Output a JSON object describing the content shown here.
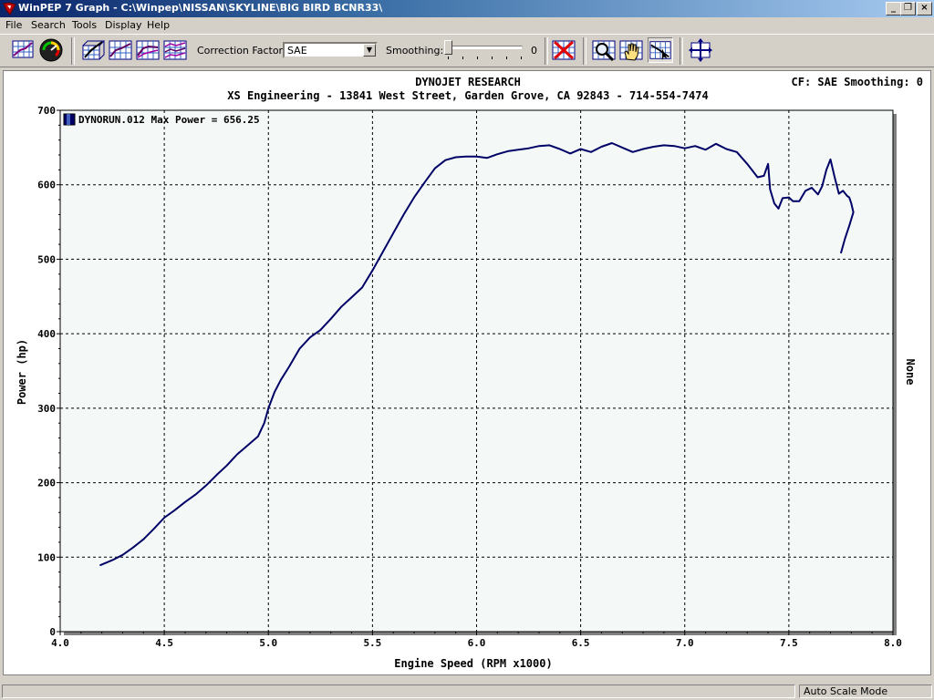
{
  "window": {
    "title": "WinPEP 7    Graph - C:\\Winpep\\NISSAN\\SKYLINE\\BIG BIRD BCNR33\\",
    "controls": {
      "minimize": "_",
      "restore": "❐",
      "close": "×"
    }
  },
  "menu": {
    "items": [
      "File",
      "Search",
      "Tools",
      "Display",
      "Help"
    ]
  },
  "toolbar": {
    "correction_label": "Correction Factor:",
    "correction_value": "SAE",
    "smoothing_label": "Smoothing:",
    "smoothing_value": "0",
    "icons": [
      "grid-view-icon",
      "gauge-icon",
      "graph-3d-icon",
      "graph-power-icon",
      "graph-torque-icon",
      "graph-multi-icon",
      "clear-runs-icon",
      "zoom-icon",
      "pan-hand-icon",
      "measure-cursor-icon",
      "axis-move-icon"
    ]
  },
  "colors": {
    "curve": "#000066",
    "plot_bg": "#f4f9f8",
    "accent": "#0a246a"
  },
  "header": {
    "company": "DYNOJET RESEARCH",
    "shop": "XS Engineering - 13841 West Street, Garden Grove, CA 92843 - 714-554-7474",
    "cf_info": "CF: SAE  Smoothing: 0"
  },
  "chart_data": {
    "type": "line",
    "title": "DYNOJET RESEARCH",
    "subtitle": "XS Engineering - 13841 West Street, Garden Grove, CA 92843 - 714-554-7474",
    "xlabel": "Engine Speed (RPM x1000)",
    "ylabel": "Power (hp)",
    "ylabel_right": "None",
    "xlim": [
      4.0,
      8.0
    ],
    "ylim": [
      0,
      700
    ],
    "xticks": [
      "4.0",
      "4.5",
      "5.0",
      "5.5",
      "6.0",
      "6.5",
      "7.0",
      "7.5",
      "8.0"
    ],
    "yticks": [
      "0",
      "100",
      "200",
      "300",
      "400",
      "500",
      "600",
      "700"
    ],
    "grid": true,
    "legend_position": "top-left",
    "series": [
      {
        "name": "DYNORUN.012 Max Power = 656.25",
        "color": "#000066",
        "points": [
          [
            4.19,
            89
          ],
          [
            4.25,
            96
          ],
          [
            4.3,
            103
          ],
          [
            4.35,
            113
          ],
          [
            4.4,
            124
          ],
          [
            4.45,
            138
          ],
          [
            4.5,
            153
          ],
          [
            4.55,
            163
          ],
          [
            4.6,
            174
          ],
          [
            4.65,
            184
          ],
          [
            4.7,
            196
          ],
          [
            4.75,
            210
          ],
          [
            4.8,
            223
          ],
          [
            4.85,
            238
          ],
          [
            4.9,
            250
          ],
          [
            4.95,
            262
          ],
          [
            4.98,
            280
          ],
          [
            5.0,
            300
          ],
          [
            5.03,
            322
          ],
          [
            5.06,
            338
          ],
          [
            5.1,
            356
          ],
          [
            5.15,
            380
          ],
          [
            5.2,
            395
          ],
          [
            5.25,
            405
          ],
          [
            5.3,
            420
          ],
          [
            5.35,
            436
          ],
          [
            5.4,
            449
          ],
          [
            5.45,
            462
          ],
          [
            5.5,
            485
          ],
          [
            5.55,
            510
          ],
          [
            5.6,
            535
          ],
          [
            5.65,
            560
          ],
          [
            5.7,
            583
          ],
          [
            5.75,
            603
          ],
          [
            5.8,
            622
          ],
          [
            5.85,
            633
          ],
          [
            5.9,
            637
          ],
          [
            5.95,
            638
          ],
          [
            6.0,
            638
          ],
          [
            6.05,
            636
          ],
          [
            6.1,
            641
          ],
          [
            6.15,
            645
          ],
          [
            6.2,
            647
          ],
          [
            6.25,
            649
          ],
          [
            6.3,
            652
          ],
          [
            6.35,
            653
          ],
          [
            6.4,
            648
          ],
          [
            6.45,
            642
          ],
          [
            6.5,
            648
          ],
          [
            6.55,
            644
          ],
          [
            6.6,
            651
          ],
          [
            6.65,
            656
          ],
          [
            6.7,
            650
          ],
          [
            6.75,
            644
          ],
          [
            6.8,
            648
          ],
          [
            6.85,
            651
          ],
          [
            6.9,
            653
          ],
          [
            6.95,
            652
          ],
          [
            7.0,
            649
          ],
          [
            7.05,
            652
          ],
          [
            7.1,
            647
          ],
          [
            7.15,
            655
          ],
          [
            7.2,
            648
          ],
          [
            7.25,
            644
          ],
          [
            7.3,
            628
          ],
          [
            7.35,
            610
          ],
          [
            7.38,
            612
          ],
          [
            7.4,
            628
          ],
          [
            7.41,
            594
          ],
          [
            7.43,
            575
          ],
          [
            7.45,
            568
          ],
          [
            7.47,
            582
          ],
          [
            7.5,
            583
          ],
          [
            7.52,
            578
          ],
          [
            7.55,
            578
          ],
          [
            7.58,
            592
          ],
          [
            7.61,
            596
          ],
          [
            7.64,
            587
          ],
          [
            7.66,
            598
          ],
          [
            7.68,
            620
          ],
          [
            7.7,
            634
          ],
          [
            7.72,
            610
          ],
          [
            7.74,
            588
          ],
          [
            7.76,
            592
          ],
          [
            7.78,
            585
          ],
          [
            7.79,
            583
          ],
          [
            7.8,
            575
          ],
          [
            7.81,
            563
          ],
          [
            7.79,
            545
          ],
          [
            7.77,
            528
          ],
          [
            7.75,
            508
          ]
        ]
      }
    ]
  },
  "status": {
    "left": "",
    "mode": "Auto Scale Mode"
  }
}
